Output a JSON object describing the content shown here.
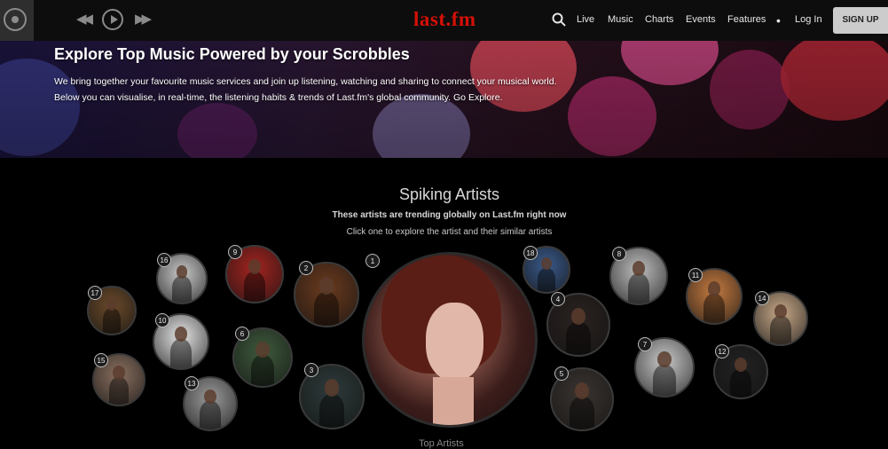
{
  "brand": {
    "logo_text": "last.fm",
    "accent": "#d51007"
  },
  "nav": {
    "items": [
      "Live",
      "Music",
      "Charts",
      "Events",
      "Features"
    ],
    "more": "•",
    "login": "Log In",
    "signup": "SIGN UP"
  },
  "player": {
    "prev_icon": "rewind-icon",
    "play_icon": "play-icon",
    "next_icon": "fast-forward-icon"
  },
  "hero": {
    "title": "Explore Top Music Powered by your Scrobbles",
    "line1": "We bring together your favourite music services and join up listening, watching and sharing to connect your musical world.",
    "line2": "Below you can visualise, in real-time, the listening habits & trends of Last.fm's global community. Go Explore."
  },
  "section": {
    "title": "Spiking Artists",
    "subtitle": "These artists are trending globally on Last.fm right now",
    "hint": "Click one to explore the artist and their similar artists"
  },
  "artists": [
    {
      "rank": "1",
      "color": "#5a2a24"
    },
    {
      "rank": "2",
      "color": "#6a3a1e"
    },
    {
      "rank": "3",
      "color": "#2e3a3a"
    },
    {
      "rank": "4",
      "color": "#2a2220"
    },
    {
      "rank": "5",
      "color": "#3a3430"
    },
    {
      "rank": "6",
      "color": "#3e5a3c"
    },
    {
      "rank": "7",
      "color": "#c8c8c8"
    },
    {
      "rank": "8",
      "color": "#bdbdbd"
    },
    {
      "rank": "9",
      "color": "#a32420"
    },
    {
      "rank": "10",
      "color": "#e4e4e4"
    },
    {
      "rank": "11",
      "color": "#c47a40"
    },
    {
      "rank": "12",
      "color": "#222222"
    },
    {
      "rank": "13",
      "color": "#9a9a9a"
    },
    {
      "rank": "14",
      "color": "#c7a888"
    },
    {
      "rank": "15",
      "color": "#8a7060"
    },
    {
      "rank": "16",
      "color": "#c9c9c9"
    },
    {
      "rank": "17",
      "color": "#6a4a2a"
    },
    {
      "rank": "18",
      "color": "#3a5a8a"
    }
  ],
  "footer_peek": "Top Artists"
}
